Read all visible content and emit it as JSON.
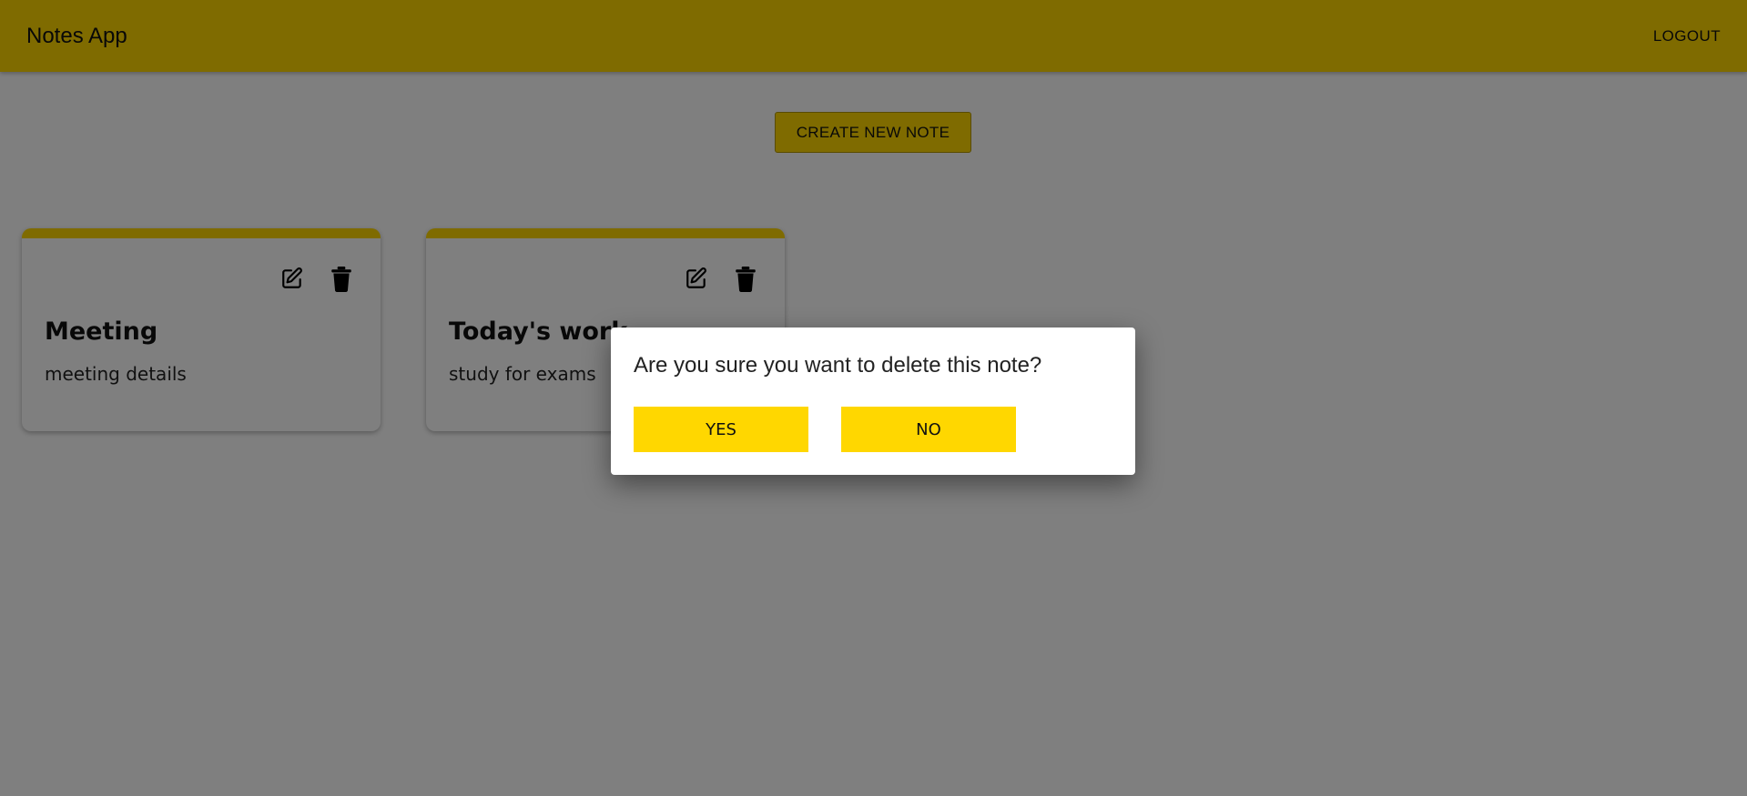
{
  "appbar": {
    "title": "Notes App",
    "logout_label": "LOGOUT"
  },
  "toolbar": {
    "create_label": "CREATE NEW NOTE"
  },
  "notes": [
    {
      "title": "Meeting",
      "body": "meeting details"
    },
    {
      "title": "Today's work",
      "body": "study for exams"
    }
  ],
  "icons": {
    "edit": "edit-icon",
    "delete": "trash-icon"
  },
  "dialog": {
    "message": "Are you sure you want to delete this note?",
    "yes_label": "YES",
    "no_label": "NO"
  },
  "colors": {
    "accent": "#ffd700",
    "overlay": "rgba(0,0,0,0.5)"
  }
}
